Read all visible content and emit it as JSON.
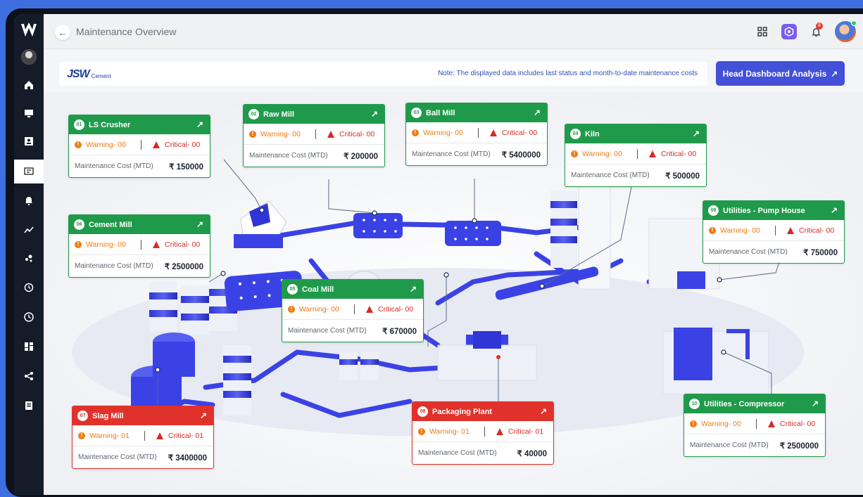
{
  "header": {
    "title": "Maintenance Overview",
    "back_icon": "arrow-left-icon",
    "notification_count": "8"
  },
  "brand": {
    "name": "JSW",
    "suffix": "Cement"
  },
  "note": "Note: The displayed data includes last status and month-to-date maintenance costs",
  "head_button": {
    "label": "Head Dashboard Analysis",
    "icon": "arrow-up-right-icon"
  },
  "sidebar": {
    "items": [
      {
        "icon": "home-icon"
      },
      {
        "icon": "monitor-icon"
      },
      {
        "icon": "id-card-icon"
      },
      {
        "icon": "chat-icon"
      },
      {
        "icon": "bell-icon"
      },
      {
        "icon": "trend-icon"
      },
      {
        "icon": "scatter-icon"
      },
      {
        "icon": "history-icon"
      },
      {
        "icon": "clock-icon"
      },
      {
        "icon": "dashboard-icon"
      },
      {
        "icon": "share-icon"
      },
      {
        "icon": "report-icon"
      }
    ],
    "active_index": 3
  },
  "labels": {
    "warning_prefix": "Warning- ",
    "critical_prefix": "Critical- ",
    "cost_label": "Maintenance Cost (MTD)"
  },
  "colors": {
    "ok": "#1f9a4a",
    "alert": "#e0322b",
    "accent": "#4350d8"
  },
  "units": [
    {
      "num": "01",
      "name": "LS Crusher",
      "status": "ok",
      "warning": "00",
      "critical": "00",
      "cost": "₹ 150000"
    },
    {
      "num": "02",
      "name": "Raw Mill",
      "status": "ok",
      "warning": "00",
      "critical": "00",
      "cost": "₹ 200000"
    },
    {
      "num": "03",
      "name": "Ball Mill",
      "status": "ok",
      "warning": "00",
      "critical": "00",
      "cost": "₹ 5400000"
    },
    {
      "num": "04",
      "name": "Kiln",
      "status": "ok",
      "warning": "00",
      "critical": "00",
      "cost": "₹ 500000"
    },
    {
      "num": "09",
      "name": "Utilities - Pump House",
      "status": "ok",
      "warning": "00",
      "critical": "00",
      "cost": "₹ 750000"
    },
    {
      "num": "06",
      "name": "Cement Mill",
      "status": "ok",
      "warning": "00",
      "critical": "00",
      "cost": "₹ 2500000"
    },
    {
      "num": "05",
      "name": "Coal Mill",
      "status": "ok",
      "warning": "00",
      "critical": "00",
      "cost": "₹ 670000"
    },
    {
      "num": "07",
      "name": "Slag Mill",
      "status": "alert",
      "warning": "01",
      "critical": "01",
      "cost": "₹ 3400000"
    },
    {
      "num": "08",
      "name": "Packaging Plant",
      "status": "alert",
      "warning": "01",
      "critical": "01",
      "cost": "₹ 40000"
    },
    {
      "num": "10",
      "name": "Utilities - Compressor",
      "status": "ok",
      "warning": "00",
      "critical": "00",
      "cost": "₹ 2500000"
    }
  ]
}
